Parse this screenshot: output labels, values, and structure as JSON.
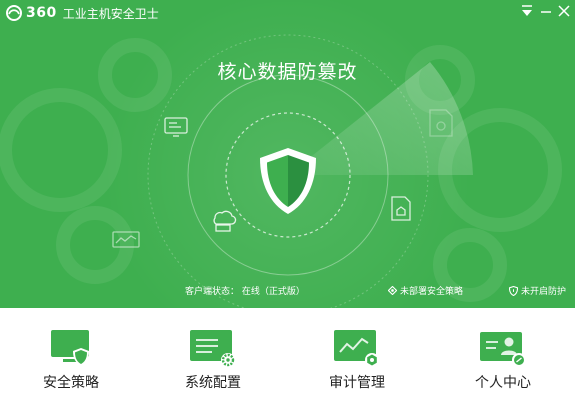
{
  "window": {
    "brand_number": "360",
    "brand_name": "工业主机安全卫士"
  },
  "hero": {
    "title": "核心数据防篡改",
    "status_label": "客户端状态：",
    "status_value": "在线（正式版）",
    "undeployed_strategy": "未部署安全策略",
    "protection_off": "未开启防护"
  },
  "nav": [
    {
      "label": "安全策略",
      "icon": "security-policy-icon"
    },
    {
      "label": "系统配置",
      "icon": "system-config-icon"
    },
    {
      "label": "审计管理",
      "icon": "audit-management-icon"
    },
    {
      "label": "个人中心",
      "icon": "personal-center-icon"
    }
  ],
  "colors": {
    "hero_green": "#3eaf4f",
    "icon_green": "#3eaf4f",
    "white": "#ffffff"
  }
}
